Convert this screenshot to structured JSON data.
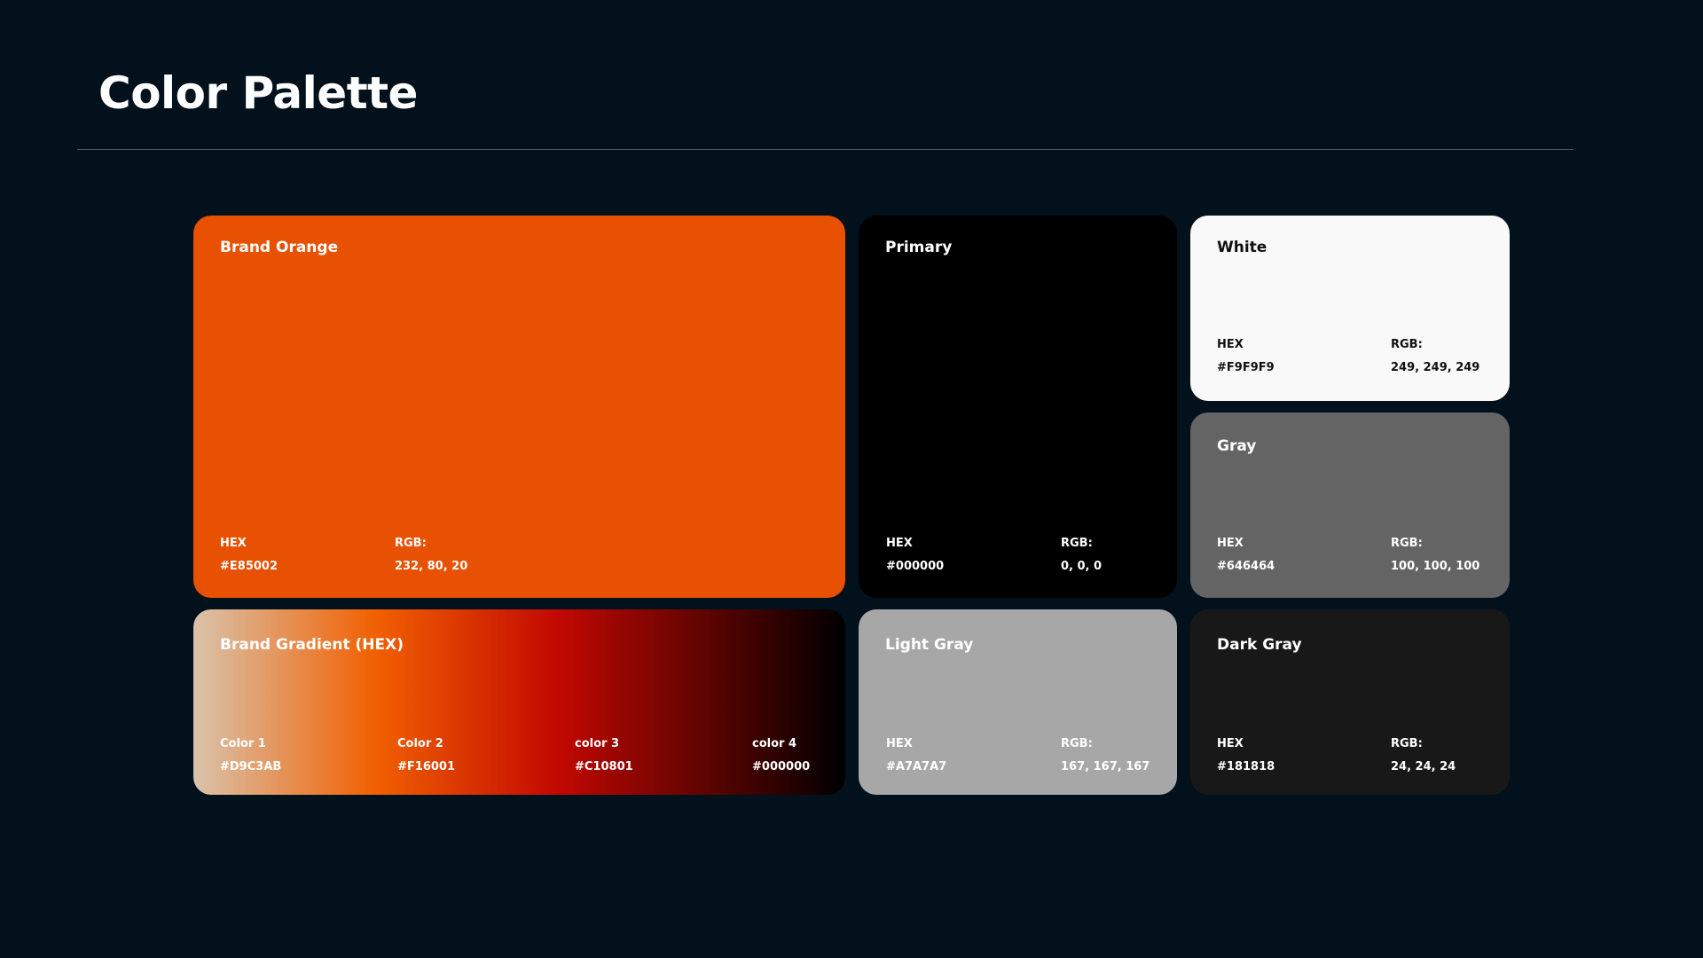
{
  "page": {
    "title": "Color Palette"
  },
  "colors": {
    "background": "#02111b",
    "divider": "#4d5860"
  },
  "cards": {
    "brand_orange": {
      "name": "Brand Orange",
      "hex_label": "HEX",
      "hex_value": "#E85002",
      "rgb_label": "RGB:",
      "rgb_value": "232, 80, 20",
      "swatch": "#E85002"
    },
    "primary": {
      "name": "Primary",
      "hex_label": "HEX",
      "hex_value": "#000000",
      "rgb_label": "RGB:",
      "rgb_value": "0, 0, 0",
      "swatch": "#000000"
    },
    "white": {
      "name": "White",
      "hex_label": "HEX",
      "hex_value": "#F9F9F9",
      "rgb_label": "RGB:",
      "rgb_value": "249, 249, 249",
      "swatch": "#F9F9F9"
    },
    "gray": {
      "name": "Gray",
      "hex_label": "HEX",
      "hex_value": "#646464",
      "rgb_label": "RGB:",
      "rgb_value": "100, 100, 100",
      "swatch": "#646464"
    },
    "brand_gradient": {
      "name": "Brand Gradient (HEX)",
      "stops": [
        {
          "label": "Color 1",
          "value": "#D9C3AB"
        },
        {
          "label": "Color 2",
          "value": "#F16001"
        },
        {
          "label": "color 3",
          "value": "#C10801"
        },
        {
          "label": "color 4",
          "value": "#000000"
        }
      ]
    },
    "light_gray": {
      "name": "Light Gray",
      "hex_label": "HEX",
      "hex_value": "#A7A7A7",
      "rgb_label": "RGB:",
      "rgb_value": "167, 167, 167",
      "swatch": "#A7A7A7"
    },
    "dark_gray": {
      "name": "Dark Gray",
      "hex_label": "HEX",
      "hex_value": "#181818",
      "rgb_label": "RGB:",
      "rgb_value": "24, 24, 24",
      "swatch": "#181818"
    }
  }
}
